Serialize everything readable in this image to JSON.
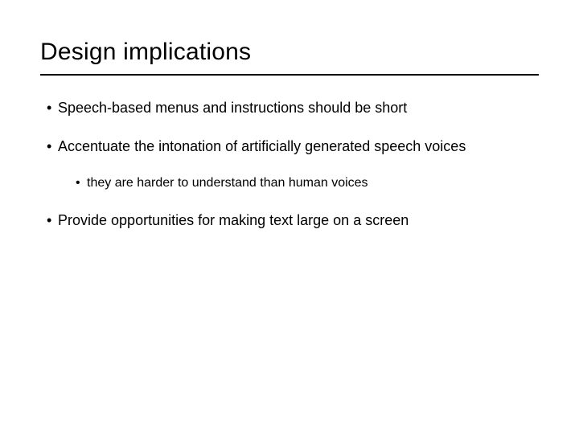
{
  "slide": {
    "title": "Design implications",
    "bullets": [
      {
        "text": "Speech-based menus and instructions should be short"
      },
      {
        "text": "Accentuate the intonation of artificially generated speech voices",
        "sub": [
          {
            "text": "they are harder to understand than human voices"
          }
        ]
      },
      {
        "text": "Provide opportunities for making text large on a screen"
      }
    ]
  }
}
